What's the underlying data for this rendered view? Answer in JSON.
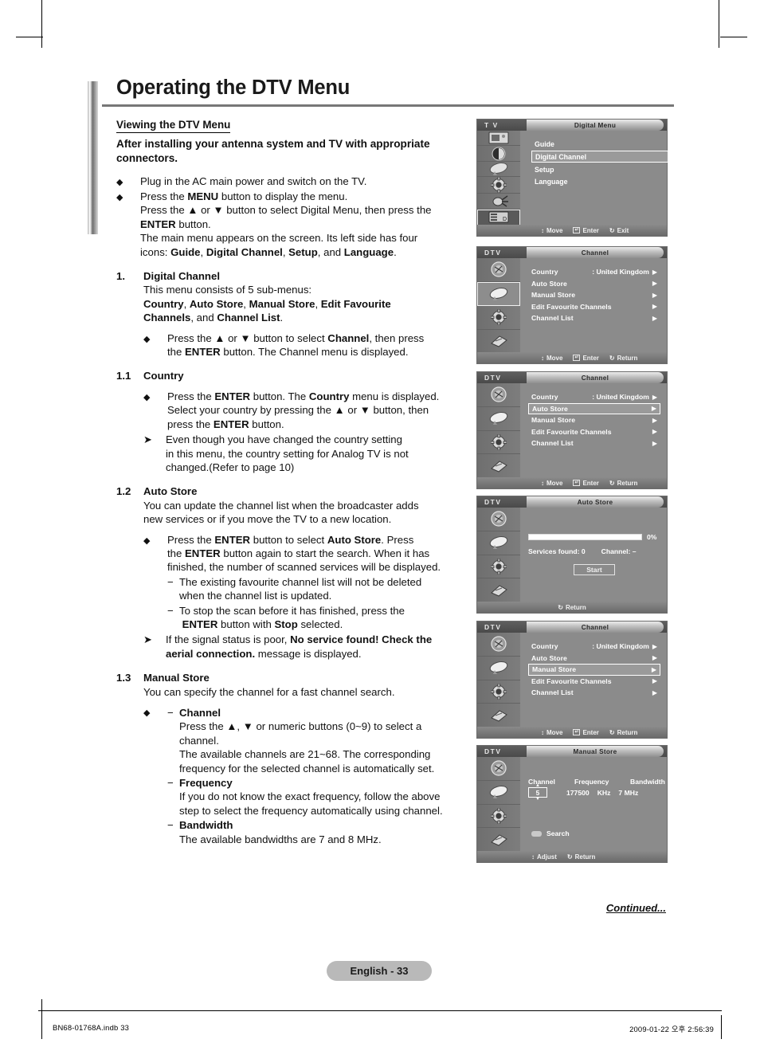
{
  "title": "Operating the DTV Menu",
  "section": {
    "subhead": "Viewing the DTV Menu",
    "lead": "After installing your antenna system and TV with appropriate connectors."
  },
  "intro_bullets": [
    {
      "text": "Plug in the AC main power and switch on the TV."
    },
    {
      "l1_a": "Press the ",
      "l1_b": "MENU",
      "l1_c": " button to display the menu.",
      "l2": "Press the ▲ or ▼ button to select Digital Menu, then press the",
      "l3_b": "ENTER",
      "l3_c": " button.",
      "l4": "The main menu appears on the screen. Its left side has four",
      "l5_pre": "icons: ",
      "l5_i1": "Guide",
      "l5_i2": "Digital Channel",
      "l5_i3": "Setup",
      "l5_i4": "Language"
    }
  ],
  "sec1": {
    "num": "1.",
    "head": "Digital Channel",
    "line1": "This menu consists of 5 sub-menus:",
    "items": [
      "Country",
      "Auto Store",
      "Manual Store",
      "Edit Favourite",
      "Channels",
      "Channel List"
    ],
    "bullet": {
      "a": "Press the ▲ or ▼ button to select ",
      "b": "Channel",
      "c": ", then press",
      "d": "the ",
      "e": "ENTER",
      "f": " button. The Channel menu is displayed."
    }
  },
  "sec11": {
    "num": "1.1",
    "head": "Country",
    "b_a": "Press the ",
    "b_enter1": "ENTER",
    "b_b": " button. The ",
    "b_country": "Country",
    "b_c": " menu is displayed.",
    "b_line2": "Select your country by pressing the ▲ or ▼ button, then",
    "b_line3_pre": "press the ",
    "b_enter2": "ENTER",
    "b_line3_post": " button.",
    "note1": "Even though you have changed the country setting",
    "note2": "in this menu, the country setting for Analog TV is not",
    "note3": "changed.(Refer to page 10)"
  },
  "sec12": {
    "num": "1.2",
    "head": "Auto Store",
    "line1": "You can update the channel list when the broadcaster adds",
    "line2": "new services or if you move the TV to a new location.",
    "b_a": "Press the ",
    "b_enter1": "ENTER",
    "b_b": " button to select ",
    "b_auto": "Auto Store",
    "b_c": ". Press",
    "b_l2_pre": "the ",
    "b_enter2": "ENTER",
    "b_l2_post": " button again to start the search. When it has",
    "b_l3": "finished, the number of scanned services will be displayed.",
    "d1_l1": "The existing favourite channel list will not be deleted",
    "d1_l2": "when the channel list is updated.",
    "d2_l1": "To stop the scan before it has finished, press the",
    "d2_l2_pre": "ENTER",
    "d2_l2_mid": " button with ",
    "d2_l2_stop": "Stop",
    "d2_l2_post": " selected.",
    "note_pre": "If the signal status is poor, ",
    "note_bold": "No service found! Check the",
    "note_bold2": "aerial connection.",
    "note_post": " message is displayed."
  },
  "sec13": {
    "num": "1.3",
    "head": "Manual Store",
    "line1": "You can specify the channel for a fast channel search.",
    "ch_head": "Channel",
    "ch_l1": "Press the ▲, ▼ or numeric buttons (0~9) to select a",
    "ch_l2": "channel.",
    "ch_l3": "The available channels are 21~68. The corresponding",
    "ch_l4": "frequency for the selected channel is automatically set.",
    "fr_head": "Frequency",
    "fr_l1": "If you do not know the exact frequency, follow the above",
    "fr_l2": "step to select the frequency automatically using channel.",
    "bw_head": "Bandwidth",
    "bw_l1": "The available bandwidths are 7 and 8 MHz."
  },
  "osd": {
    "foot_move": "Move",
    "foot_enter": "Enter",
    "foot_exit": "Exit",
    "foot_return": "Return",
    "foot_adjust": "Adjust",
    "screens": [
      {
        "source": "T V",
        "title": "Digital Menu",
        "rail": [
          "picture-icon",
          "sound-icon",
          "channel-dish-icon",
          "setup-gear-icon",
          "input-icon",
          "digital-menu-icon"
        ],
        "rail_selected": 5,
        "items": [
          {
            "label": "Guide",
            "highlight": false
          },
          {
            "label": "Digital Channel",
            "highlight": true
          },
          {
            "label": "Setup",
            "highlight": false
          },
          {
            "label": "Language",
            "highlight": false
          }
        ],
        "footer": [
          "Move",
          "Enter",
          "Exit"
        ]
      },
      {
        "source": "DTV",
        "title": "Channel",
        "rail": [
          "guide-icon",
          "channel-dish-icon",
          "setup-gear-icon",
          "language-icon"
        ],
        "rail_selected": 1,
        "rows": [
          {
            "label": "Country",
            "value": ": United Kingdom",
            "arrow": true,
            "highlight": false
          },
          {
            "label": "Auto Store",
            "value": "",
            "arrow": true,
            "highlight": false
          },
          {
            "label": "Manual Store",
            "value": "",
            "arrow": true,
            "highlight": false
          },
          {
            "label": "Edit Favourite Channels",
            "value": "",
            "arrow": true,
            "highlight": false
          },
          {
            "label": "Channel List",
            "value": "",
            "arrow": true,
            "highlight": false
          }
        ],
        "footer": [
          "Move",
          "Enter",
          "Return"
        ]
      },
      {
        "source": "DTV",
        "title": "Channel",
        "rail": [
          "guide-icon",
          "channel-dish-icon",
          "setup-gear-icon",
          "language-icon"
        ],
        "rail_selected": -1,
        "rows": [
          {
            "label": "Country",
            "value": ": United Kingdom",
            "arrow": true,
            "highlight": false
          },
          {
            "label": "Auto Store",
            "value": "",
            "arrow": true,
            "highlight": true
          },
          {
            "label": "Manual Store",
            "value": "",
            "arrow": true,
            "highlight": false
          },
          {
            "label": "Edit Favourite Channels",
            "value": "",
            "arrow": true,
            "highlight": false
          },
          {
            "label": "Channel List",
            "value": "",
            "arrow": true,
            "highlight": false
          }
        ],
        "footer": [
          "Move",
          "Enter",
          "Return"
        ]
      },
      {
        "source": "DTV",
        "title": "Auto Store",
        "rail": [
          "guide-icon",
          "channel-dish-icon",
          "setup-gear-icon",
          "language-icon"
        ],
        "rail_selected": -1,
        "progress_percent": "0%",
        "progress_value": 0,
        "services_found": "Services found: 0",
        "channel": "Channel: –",
        "start_label": "Start",
        "footer": [
          "Return"
        ]
      },
      {
        "source": "DTV",
        "title": "Channel",
        "rail": [
          "guide-icon",
          "channel-dish-icon",
          "setup-gear-icon",
          "language-icon"
        ],
        "rail_selected": -1,
        "rows": [
          {
            "label": "Country",
            "value": ": United Kingdom",
            "arrow": true,
            "highlight": false
          },
          {
            "label": "Auto Store",
            "value": "",
            "arrow": true,
            "highlight": false
          },
          {
            "label": "Manual Store",
            "value": "",
            "arrow": true,
            "highlight": true
          },
          {
            "label": "Edit Favourite Channels",
            "value": "",
            "arrow": true,
            "highlight": false
          },
          {
            "label": "Channel List",
            "value": "",
            "arrow": true,
            "highlight": false
          }
        ],
        "footer": [
          "Move",
          "Enter",
          "Return"
        ]
      },
      {
        "source": "DTV",
        "title": "Manual Store",
        "rail": [
          "guide-icon",
          "channel-dish-icon",
          "setup-gear-icon",
          "language-icon"
        ],
        "rail_selected": -1,
        "table_headers": [
          "Channel",
          "Frequency",
          "Bandwidth"
        ],
        "table_values": [
          "5",
          "177500",
          "KHz",
          "7 MHz"
        ],
        "search_label": "Search",
        "footer": [
          "Adjust",
          "Return"
        ]
      }
    ]
  },
  "continued": "Continued...",
  "page_badge": "English - 33",
  "print_footer": {
    "left": "BN68-01768A.indb   33",
    "right": "2009-01-22   오후 2:56:39"
  }
}
